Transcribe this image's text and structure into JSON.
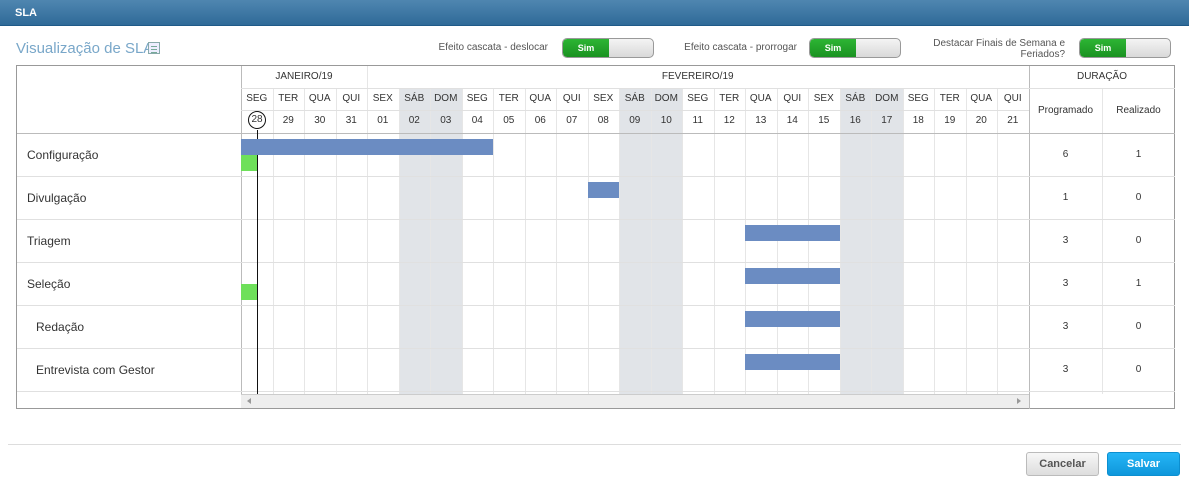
{
  "window": {
    "title": "SLA"
  },
  "page": {
    "title": "Visualização de SLA"
  },
  "toggles": [
    {
      "label": "Efeito cascata - deslocar",
      "value": "Sim"
    },
    {
      "label": "Efeito cascata - prorrogar",
      "value": "Sim"
    },
    {
      "label": "Destacar Finais de Semana e Feriados?",
      "value": "Sim"
    }
  ],
  "gantt": {
    "months": [
      {
        "label": "JANEIRO/19",
        "days": 4
      },
      {
        "label": "FEVEREIRO/19",
        "days": 21
      }
    ],
    "days": [
      {
        "wd": "SEG",
        "d": "28",
        "today": true
      },
      {
        "wd": "TER",
        "d": "29"
      },
      {
        "wd": "QUA",
        "d": "30"
      },
      {
        "wd": "QUI",
        "d": "31"
      },
      {
        "wd": "SEX",
        "d": "01"
      },
      {
        "wd": "SÁB",
        "d": "02",
        "weekend": true
      },
      {
        "wd": "DOM",
        "d": "03",
        "weekend": true
      },
      {
        "wd": "SEG",
        "d": "04"
      },
      {
        "wd": "TER",
        "d": "05"
      },
      {
        "wd": "QUA",
        "d": "06"
      },
      {
        "wd": "QUI",
        "d": "07"
      },
      {
        "wd": "SEX",
        "d": "08"
      },
      {
        "wd": "SÁB",
        "d": "09",
        "weekend": true
      },
      {
        "wd": "DOM",
        "d": "10",
        "weekend": true
      },
      {
        "wd": "SEG",
        "d": "11"
      },
      {
        "wd": "TER",
        "d": "12"
      },
      {
        "wd": "QUA",
        "d": "13"
      },
      {
        "wd": "QUI",
        "d": "14"
      },
      {
        "wd": "SEX",
        "d": "15"
      },
      {
        "wd": "SÁB",
        "d": "16",
        "weekend": true
      },
      {
        "wd": "DOM",
        "d": "17",
        "weekend": true
      },
      {
        "wd": "SEG",
        "d": "18"
      },
      {
        "wd": "TER",
        "d": "19"
      },
      {
        "wd": "QUA",
        "d": "20"
      },
      {
        "wd": "QUI",
        "d": "21"
      }
    ],
    "duration_header": "DURAÇÃO",
    "programado_header": "Programado",
    "realizado_header": "Realizado",
    "tasks": [
      {
        "name": "Configuração",
        "programado": "6",
        "realizado": "1",
        "planned": {
          "start": 0,
          "days": 8
        },
        "actual": {
          "start": 0,
          "days": 0.5
        }
      },
      {
        "name": "Divulgação",
        "programado": "1",
        "realizado": "0",
        "planned": {
          "start": 11,
          "days": 1
        }
      },
      {
        "name": "Triagem",
        "programado": "3",
        "realizado": "0",
        "planned": {
          "start": 16,
          "days": 3
        }
      },
      {
        "name": "Seleção",
        "programado": "3",
        "realizado": "1",
        "planned": {
          "start": 16,
          "days": 3
        },
        "actual": {
          "start": 0,
          "days": 0.5
        }
      },
      {
        "name": "Redação",
        "programado": "3",
        "realizado": "0",
        "indent": true,
        "planned": {
          "start": 16,
          "days": 3
        }
      },
      {
        "name": "Entrevista com Gestor",
        "programado": "3",
        "realizado": "0",
        "indent": true,
        "planned": {
          "start": 16,
          "days": 3
        }
      }
    ]
  },
  "footer": {
    "cancel": "Cancelar",
    "save": "Salvar"
  },
  "colors": {
    "planned_bar": "#6b8cc2",
    "actual_bar": "#6ee05a",
    "toggle_on": "#1fa126",
    "save_button": "#15a3e6",
    "weekend": "#e1e4e8"
  }
}
